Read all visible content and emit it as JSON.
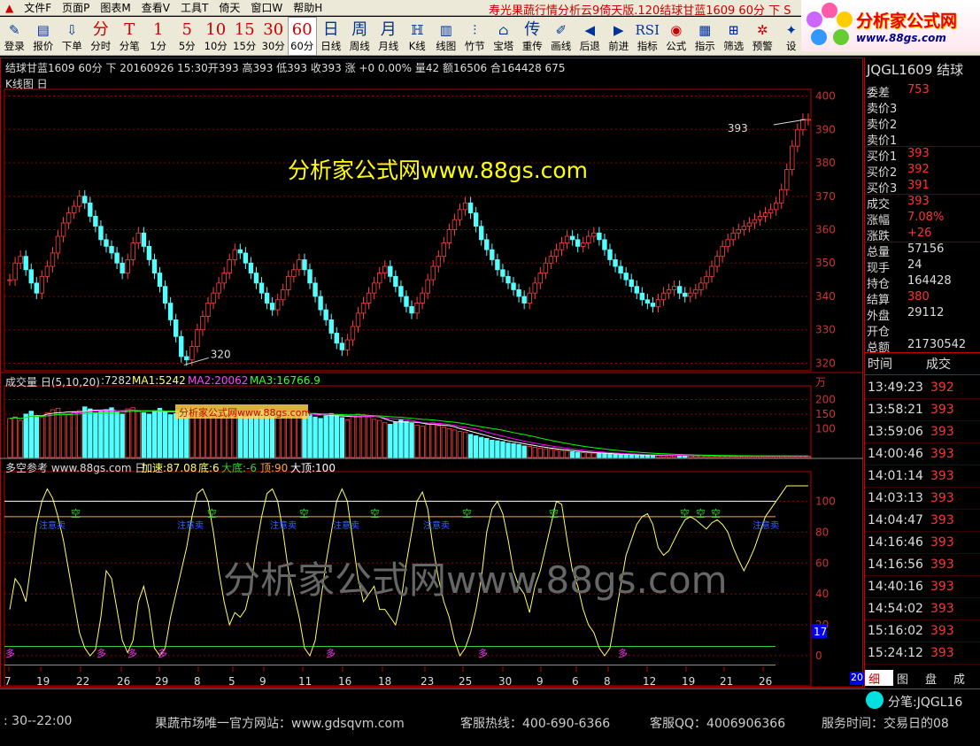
{
  "menubar": {
    "items": [
      "文件F",
      "页面P",
      "图表M",
      "查看V",
      "工具T",
      "倚天",
      "窗口W",
      "帮助H"
    ],
    "title_text": "寿光果蔬行情分析云9倚天版.120结球甘蓝1609 60分 下 S"
  },
  "toolbar": {
    "buttons": [
      {
        "glyph": "✎",
        "label": "登录",
        "color": "blue",
        "ico": true
      },
      {
        "glyph": "▤",
        "label": "报价",
        "color": "blue",
        "ico": true
      },
      {
        "glyph": "⇩",
        "label": "下单",
        "color": "blue",
        "ico": true
      },
      {
        "glyph": "分",
        "label": "分时",
        "color": "red"
      },
      {
        "glyph": "T",
        "label": "分笔",
        "color": "red"
      },
      {
        "glyph": "1",
        "label": "1分",
        "color": "red"
      },
      {
        "glyph": "5",
        "label": "5分",
        "color": "red"
      },
      {
        "glyph": "10",
        "label": "10分",
        "color": "red"
      },
      {
        "glyph": "15",
        "label": "15分",
        "color": "red"
      },
      {
        "glyph": "30",
        "label": "30分",
        "color": "red"
      },
      {
        "glyph": "60",
        "label": "60分",
        "color": "red",
        "active": true
      },
      {
        "glyph": "日",
        "label": "日线",
        "color": "blue"
      },
      {
        "glyph": "周",
        "label": "周线",
        "color": "blue"
      },
      {
        "glyph": "月",
        "label": "月线",
        "color": "blue"
      },
      {
        "glyph": "ℍ",
        "label": "K线",
        "color": "blue",
        "ico": true
      },
      {
        "glyph": "▥",
        "label": "线图",
        "color": "blue",
        "ico": true
      },
      {
        "glyph": "⫶",
        "label": "竹节",
        "color": "blue",
        "ico": true
      },
      {
        "glyph": "⌂",
        "label": "宝塔",
        "color": "blue",
        "ico": true
      },
      {
        "glyph": "传",
        "label": "重传",
        "color": "blue"
      },
      {
        "glyph": "✐",
        "label": "画线",
        "color": "blue",
        "ico": true
      },
      {
        "glyph": "◀",
        "label": "后退",
        "color": "blue",
        "ico": true
      },
      {
        "glyph": "▶",
        "label": "前进",
        "color": "blue",
        "ico": true
      },
      {
        "glyph": "RSI",
        "label": "指标",
        "color": "blue",
        "ico": true
      },
      {
        "glyph": "◉",
        "label": "公式",
        "color": "red",
        "ico": true
      },
      {
        "glyph": "▦",
        "label": "指示",
        "color": "blue",
        "ico": true
      },
      {
        "glyph": "⊞",
        "label": "筛选",
        "color": "blue",
        "ico": true
      },
      {
        "glyph": "✲",
        "label": "预警",
        "color": "red",
        "ico": true
      },
      {
        "glyph": "✦",
        "label": "设",
        "color": "blue",
        "ico": true
      }
    ]
  },
  "logo": {
    "title": "分析家公式网",
    "url": "www.88gs.com"
  },
  "chart_header": {
    "info": "结球甘蓝1609 60分 下 20160926 15:30开393 高393 低393 收393 涨 +0 0.00% 量42 额16506 合164428 675",
    "kline_label": "K线图 日",
    "max_label": "393",
    "min_label": "320",
    "watermark": "分析家公式网www.88gs.com",
    "watermark_big": "分析家公式网www.88gs.com",
    "watermark_small": "分析家公式网www.88gs.com",
    "price_ticks": [
      "400",
      "390",
      "380",
      "370",
      "360",
      "350",
      "340",
      "330",
      "320"
    ]
  },
  "volume": {
    "title": "成交量 日(5,10,20)",
    "value": ":7282",
    "ma1": "MA1:5242",
    "ma2": "MA2:20062",
    "ma3": "MA3:16766.9",
    "unit": "万",
    "ticks": [
      "200",
      "150",
      "100"
    ]
  },
  "indicator": {
    "title": "多空参考 www.88gs.com 日",
    "accel": "加速:87.08",
    "bottom": "底:6",
    "bigbottom": "大底:-6",
    "top": "顶:90",
    "bigtop": "大顶:100",
    "ticks": [
      "100",
      "80",
      "60",
      "40",
      "20",
      "0"
    ],
    "cursor_value": "17",
    "kong": "空",
    "duo": "多",
    "zhuan": "注意卖"
  },
  "x_axis": [
    "7",
    "19",
    "22",
    "26",
    "29",
    "8",
    "5",
    "9",
    "11",
    "16",
    "18",
    "23",
    "25",
    "30",
    "9",
    "6",
    "8",
    "12",
    "19",
    "21",
    "26"
  ],
  "x_axis_right": "20",
  "quote": {
    "code": "JQGL1609 结球",
    "rows": [
      {
        "k": "委差",
        "v": "753",
        "c": "#ff3333"
      },
      {
        "k": "卖价3",
        "v": "",
        "c": "#ff3333"
      },
      {
        "k": "卖价2",
        "v": "",
        "c": "#ff3333"
      },
      {
        "k": "卖价1",
        "v": "",
        "c": "#ff3333"
      },
      {
        "k": "买价1",
        "v": "393",
        "c": "#ff3333"
      },
      {
        "k": "买价2",
        "v": "392",
        "c": "#ff3333"
      },
      {
        "k": "买价3",
        "v": "391",
        "c": "#ff3333"
      },
      {
        "k": "成交",
        "v": "393",
        "c": "#ff3333"
      },
      {
        "k": "涨幅",
        "v": "7.08%",
        "c": "#ff3333"
      },
      {
        "k": "涨跌",
        "v": "+26",
        "c": "#ff3333"
      },
      {
        "k": "总量",
        "v": "57156",
        "c": "#dddddd"
      },
      {
        "k": "现手",
        "v": "24",
        "c": "#dddddd"
      },
      {
        "k": "持仓",
        "v": "164428",
        "c": "#dddddd"
      },
      {
        "k": "结算",
        "v": "380",
        "c": "#ff3333"
      },
      {
        "k": "外盘",
        "v": "29112",
        "c": "#dddddd"
      },
      {
        "k": "开仓",
        "v": "",
        "c": "#dddddd"
      },
      {
        "k": "总额",
        "v": "21730542",
        "c": "#dddddd"
      }
    ],
    "ticks_header": {
      "time": "时间",
      "vol": "成交"
    },
    "ticks": [
      {
        "t": "13:49:23",
        "p": "392"
      },
      {
        "t": "13:58:21",
        "p": "393"
      },
      {
        "t": "13:59:06",
        "p": "393"
      },
      {
        "t": "14:00:46",
        "p": "393"
      },
      {
        "t": "14:01:14",
        "p": "393"
      },
      {
        "t": "14:03:13",
        "p": "393"
      },
      {
        "t": "14:04:47",
        "p": "393"
      },
      {
        "t": "14:16:46",
        "p": "393"
      },
      {
        "t": "14:16:56",
        "p": "393"
      },
      {
        "t": "14:40:16",
        "p": "393"
      },
      {
        "t": "14:54:02",
        "p": "393"
      },
      {
        "t": "15:16:02",
        "p": "393"
      },
      {
        "t": "15:24:12",
        "p": "393"
      }
    ],
    "tabs": [
      "细",
      "图",
      "盘",
      "成"
    ],
    "fenbi": "分笔:JQGL16"
  },
  "status": {
    "left": ": 30--22:00",
    "site": "果蔬市场唯一官方网站：www.gdsqvm.com",
    "hotline": "客服热线：400-690-6366",
    "qq": "客服QQ：4006906366",
    "service": "服务时间：交易日的08"
  },
  "colors": {
    "up": "#ff4040",
    "down": "#54ffff",
    "grid": "#8b0000",
    "ma1": "#ffffff",
    "ma2": "#ff00ff",
    "ma3": "#00ff00"
  },
  "chart_data": {
    "type": "candlestick",
    "ylim": [
      318,
      402
    ],
    "close": [
      345,
      350,
      352,
      348,
      344,
      341,
      346,
      349,
      353,
      358,
      362,
      365,
      367,
      370,
      368,
      364,
      361,
      357,
      355,
      353,
      350,
      347,
      351,
      356,
      359,
      355,
      351,
      347,
      343,
      338,
      333,
      328,
      322,
      321,
      325,
      330,
      334,
      338,
      341,
      344,
      347,
      351,
      354,
      353,
      350,
      347,
      344,
      341,
      338,
      336,
      339,
      342,
      346,
      348,
      351,
      348,
      344,
      340,
      336,
      333,
      329,
      326,
      324,
      327,
      331,
      335,
      338,
      341,
      344,
      347,
      349,
      346,
      343,
      340,
      337,
      335,
      338,
      341,
      345,
      349,
      352,
      356,
      360,
      363,
      366,
      368,
      365,
      361,
      357,
      354,
      351,
      348,
      346,
      344,
      342,
      340,
      338,
      341,
      344,
      347,
      350,
      352,
      354,
      356,
      358,
      357,
      355,
      356,
      358,
      359,
      357,
      354,
      351,
      349,
      347,
      345,
      343,
      341,
      339,
      338,
      337,
      339,
      341,
      342,
      343,
      341,
      340,
      341,
      342,
      344,
      346,
      349,
      352,
      355,
      357,
      359,
      360,
      361,
      362,
      363,
      364,
      365,
      366,
      368,
      372,
      378,
      385,
      390,
      393,
      393
    ],
    "volume": [
      135,
      140,
      128,
      150,
      160,
      145,
      138,
      155,
      165,
      170,
      150,
      148,
      158,
      162,
      175,
      168,
      155,
      160,
      165,
      172,
      158,
      150,
      168,
      172,
      160,
      155,
      150,
      162,
      170,
      158,
      148,
      152,
      160,
      165,
      170,
      158,
      150,
      145,
      155,
      160,
      168,
      162,
      150,
      148,
      140,
      152,
      158,
      165,
      155,
      145,
      138,
      150,
      142,
      148,
      160,
      155,
      150,
      140,
      135,
      148,
      152,
      145,
      138,
      130,
      142,
      150,
      148,
      140,
      132,
      128,
      120,
      115,
      122,
      130,
      125,
      118,
      112,
      108,
      115,
      120,
      110,
      105,
      100,
      95,
      90,
      88,
      80,
      75,
      70,
      66,
      60,
      58,
      55,
      50,
      48,
      45,
      40,
      38,
      35,
      32,
      30,
      28,
      26,
      24,
      22,
      20,
      18,
      17,
      16,
      15,
      14,
      13,
      12,
      11,
      10,
      10,
      9,
      9,
      8,
      8,
      8,
      7,
      7,
      7,
      7,
      6,
      6,
      6,
      6,
      6,
      5,
      5,
      5,
      5,
      5,
      5,
      5,
      5,
      5,
      5,
      5,
      5,
      5,
      5,
      5,
      5,
      5,
      5,
      5,
      5
    ],
    "indicator": [
      30,
      50,
      45,
      35,
      60,
      85,
      100,
      108,
      102,
      90,
      75,
      55,
      35,
      15,
      5,
      0,
      4,
      25,
      55,
      50,
      30,
      10,
      2,
      10,
      35,
      45,
      30,
      5,
      0,
      5,
      25,
      40,
      55,
      70,
      90,
      105,
      108,
      100,
      80,
      55,
      35,
      20,
      28,
      25,
      30,
      45,
      70,
      90,
      105,
      108,
      100,
      80,
      55,
      40,
      25,
      5,
      0,
      10,
      35,
      60,
      80,
      100,
      108,
      100,
      75,
      50,
      35,
      40,
      45,
      30,
      30,
      25,
      20,
      35,
      60,
      80,
      100,
      106,
      95,
      70,
      50,
      35,
      25,
      10,
      0,
      5,
      15,
      30,
      50,
      80,
      95,
      100,
      92,
      75,
      55,
      45,
      40,
      28,
      45,
      55,
      70,
      85,
      100,
      98,
      75,
      55,
      45,
      30,
      20,
      15,
      5,
      0,
      5,
      25,
      45,
      65,
      75,
      85,
      90,
      92,
      85,
      70,
      65,
      68,
      75,
      82,
      88,
      90,
      88,
      85,
      82,
      86,
      88,
      85,
      80,
      70,
      62,
      55,
      62,
      70,
      80,
      90,
      95,
      100,
      105,
      110,
      110,
      110,
      110,
      110
    ]
  }
}
